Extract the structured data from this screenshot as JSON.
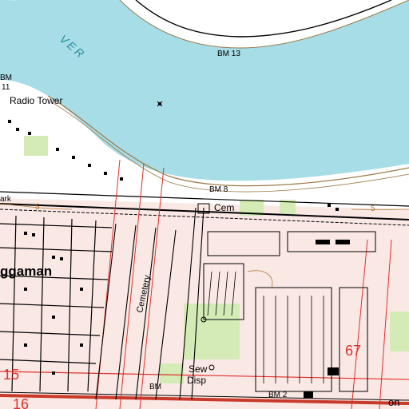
{
  "map": {
    "labels": {
      "river": "VER",
      "bm13": "BM 13",
      "radio_tower": "Radio Tower",
      "bm_top_left": "BM",
      "eleven": "11",
      "park_frag": "ark",
      "bm8": "BM 8",
      "cem": "Cem",
      "town": "ggaman",
      "cemetery_road": "Cemetery",
      "contour_5_left": "5",
      "contour_5_right": "5",
      "sew": "Sew",
      "disp": "Disp",
      "bm_bottom": "BM",
      "bm2": "BM 2",
      "on_frag": "on",
      "section_67": "67",
      "section_15": "15",
      "section_16": "16"
    },
    "colors": {
      "water": "#a6dde6",
      "land": "#ffffff",
      "urban_tint": "#f2c9c0",
      "vegetation": "#d4ebb6",
      "road": "#000000",
      "contour": "#b07838",
      "grid_red": "#e0302a",
      "highway": "#c83a2a"
    }
  }
}
